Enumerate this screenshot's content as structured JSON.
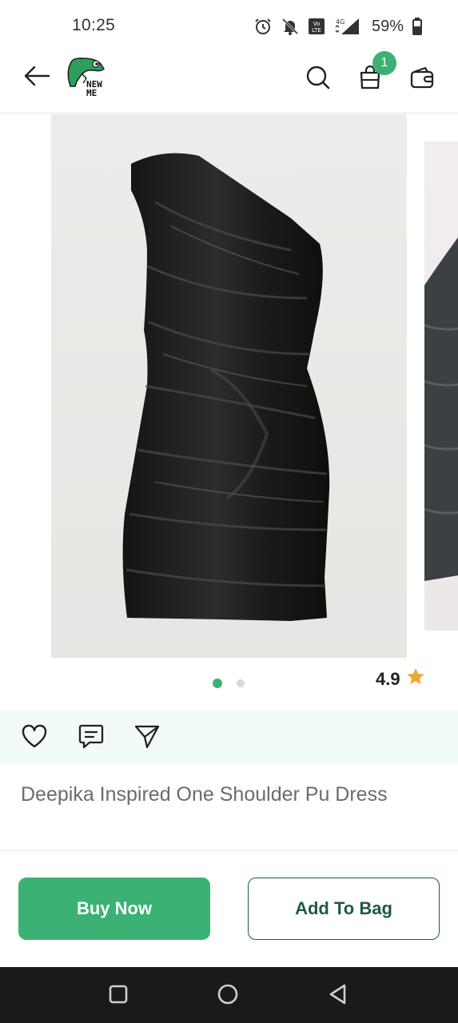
{
  "status_bar": {
    "time": "10:25",
    "battery": "59%",
    "icons": [
      "alarm-icon",
      "mute-icon",
      "volte-icon",
      "signal-4g-icon",
      "battery-icon"
    ]
  },
  "header": {
    "logo_text_line1": "NEW",
    "logo_text_line2": "ME",
    "cart_count": "1",
    "icons": [
      "back-arrow-icon",
      "search-icon",
      "shopping-bag-icon",
      "wallet-icon"
    ]
  },
  "gallery": {
    "image_count": 2,
    "active_index": 0
  },
  "product": {
    "rating": "4.9",
    "title": "Deepika Inspired One Shoulder Pu Dress"
  },
  "actions": {
    "icons": [
      "heart-icon",
      "comment-icon",
      "share-icon"
    ]
  },
  "buttons": {
    "buy_now": "Buy Now",
    "add_to_bag": "Add To Bag"
  },
  "colors": {
    "accent": "#3bb273",
    "dark_green": "#1e5a45",
    "star": "#f0a830",
    "action_strip_bg": "#f3fbf8",
    "nav_bar_bg": "#1a1a1a"
  }
}
